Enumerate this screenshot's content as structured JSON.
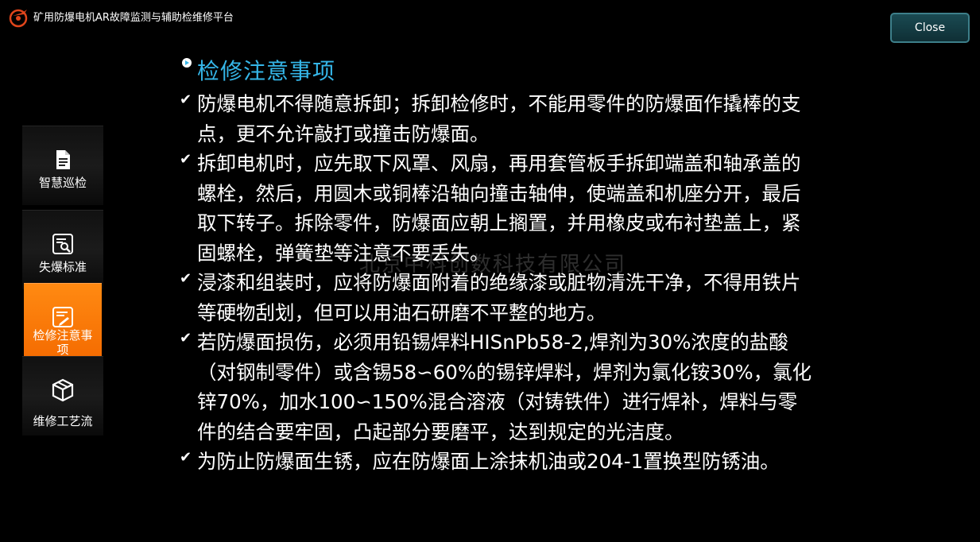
{
  "app": {
    "title": "矿用防爆电机AR故障监测与辅助检维修平台",
    "close_label": "Close"
  },
  "sidebar": {
    "items": [
      {
        "label": "智慧巡检",
        "icon": "document-icon",
        "active": false
      },
      {
        "label": "失爆标准",
        "icon": "inspect-icon",
        "active": false
      },
      {
        "label": "检修注意事项",
        "icon": "repair-notes-icon",
        "active": true
      },
      {
        "label": "维修工艺流",
        "icon": "cube-icon",
        "active": false
      }
    ]
  },
  "content": {
    "heading": "检修注意事项",
    "items": [
      "防爆电机不得随意拆卸；拆卸检修时，不能用零件的防爆面作撬棒的支点，更不允许敲打或撞击防爆面。",
      "拆卸电机时，应先取下风罩、风扇，再用套管板手拆卸端盖和轴承盖的螺栓，然后，用圆木或铜棒沿轴向撞击轴伸，使端盖和机座分开，最后取下转子。拆除零件，防爆面应朝上搁置，并用橡皮或布衬垫盖上，紧固螺栓，弹簧垫等注意不要丢失。",
      "浸漆和组装时，应将防爆面附着的绝缘漆或脏物清洗干净，不得用铁片等硬物刮划，但可以用油石研磨不平整的地方。",
      "若防爆面损伤，必须用铅锡焊料HISnPb58-2,焊剂为30%浓度的盐酸（对钢制零件）或含锡58∽60%的锡锌焊料，焊剂为氯化铵30%，氯化锌70%，加水100∽150%混合溶液（对铸铁件）进行焊补，焊料与零件的结合要牢固，凸起部分要磨平，达到规定的光洁度。",
      "为防止防爆面生锈，应在防爆面上涂抹机油或204-1置换型防锈油。"
    ]
  },
  "watermark": "北京中科创数科技有限公司",
  "colors": {
    "accent_orange": "#f47a08",
    "heading_blue": "#35b6e8",
    "close_border": "#3d7f8a"
  }
}
